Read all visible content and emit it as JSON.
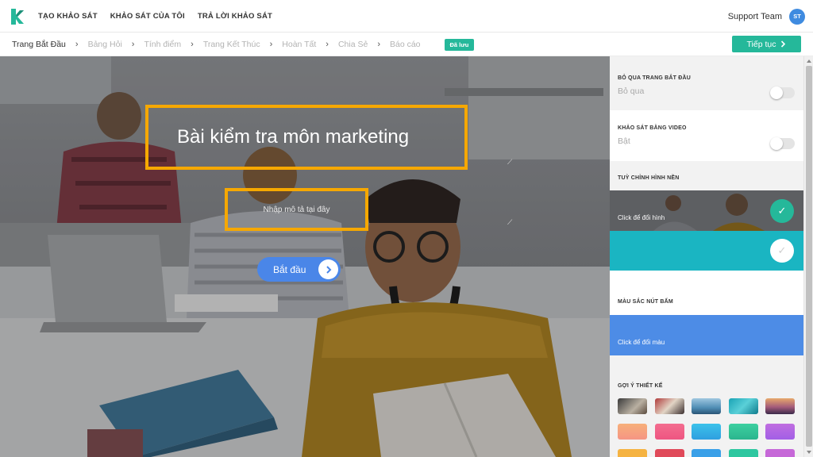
{
  "nav": {
    "items": [
      "TẠO KHẢO SÁT",
      "KHẢO SÁT CỦA TÔI",
      "TRẢ LỜI KHẢO SÁT"
    ],
    "user_name": "Support Team",
    "avatar_initials": "ST"
  },
  "steps": {
    "items": [
      "Trang Bắt Đầu",
      "Bảng Hỏi",
      "Tính điểm",
      "Trang Kết Thúc",
      "Hoàn Tất",
      "Chia Sẻ",
      "Báo cáo"
    ],
    "separator": "›",
    "saved_badge": "Đã lưu",
    "next_label": "Tiếp tục",
    "next_icon": "chevron-right-icon"
  },
  "canvas": {
    "title": "Bài kiểm tra môn marketing",
    "description_placeholder": "Nhập mô tả tại đây",
    "start_label": "Bắt đầu",
    "resize_glyph": "⟋"
  },
  "panel": {
    "skip_start": {
      "title": "BỎ QUA TRANG BẮT ĐẦU",
      "label": "Bỏ qua",
      "enabled": false
    },
    "video": {
      "title": "KHẢO SÁT BẰNG VIDEO",
      "label": "Bật",
      "enabled": false
    },
    "background": {
      "title": "TUỲ CHỈNH HÌNH NỀN",
      "image_caption": "Click để đổi hình",
      "selected": "image",
      "teal_color": "#1ab5c2"
    },
    "button_color": {
      "title": "MÀU SẮC NÚT BẤM",
      "caption": "Click để đổi màu",
      "color": "#4d8ce6"
    },
    "design_suggestions": {
      "title": "GỢI Ý THIẾT KẾ",
      "image_swatches": [
        "classroom",
        "people",
        "ocean",
        "teal-wave",
        "sunset"
      ],
      "color_swatches": [
        "#f6a580",
        "#f26b8e",
        "#38b6e8",
        "#35c79a",
        "#b56ee0"
      ],
      "color_swatches_row3": [
        "#f5b342",
        "#e04a5a",
        "#3aa0e8",
        "#2ec7a0",
        "#c668d8"
      ]
    }
  },
  "colors": {
    "accent": "#25b89a",
    "highlight_border": "#f6a800",
    "button_blue": "#4a86e8"
  }
}
